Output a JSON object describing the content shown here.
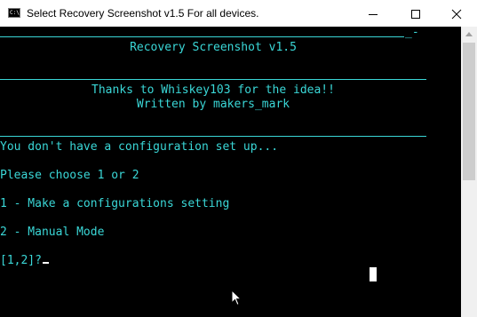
{
  "window": {
    "title": "Select Recovery Screenshot v1.5 For all devices.",
    "icon_text": "C:\\"
  },
  "controls": {
    "minimize": "minimize-icon",
    "maximize": "maximize-icon",
    "close": "close-icon"
  },
  "console": {
    "top_rule_suffix": "_-",
    "header_title": "Recovery Screenshot v1.5",
    "credits_line1": "Thanks to Whiskey103 for the idea!!",
    "credits_line2": "Written by makers_mark",
    "message_no_config": "You don't have a configuration set up...",
    "prompt_choose": "Please choose 1 or 2",
    "option_1": "1 - Make a configurations setting",
    "option_2": "2 - Manual Mode",
    "input_prompt": "[1,2]?"
  },
  "colors": {
    "console_text": "#3ad7d7",
    "console_background": "#000000",
    "cursor": "#ffffff"
  }
}
